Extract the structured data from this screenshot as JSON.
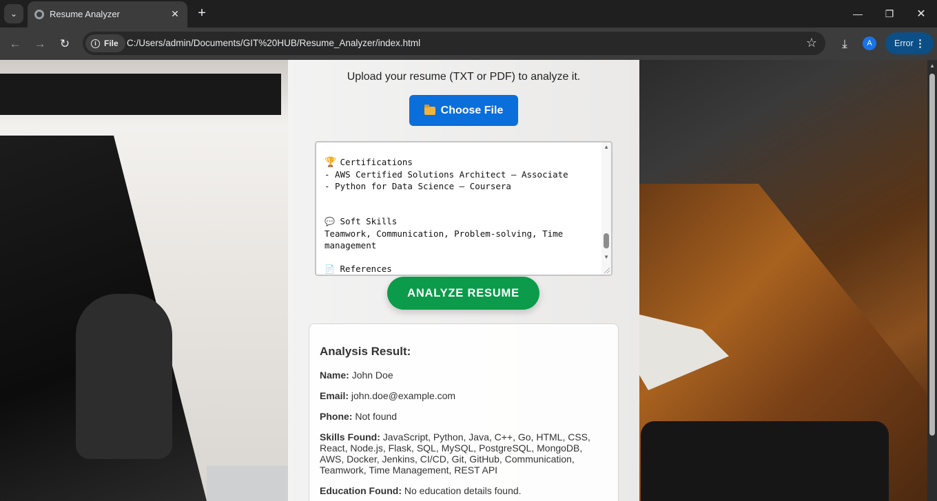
{
  "browser": {
    "tab_title": "Resume Analyzer",
    "chip_label": "File",
    "url": "C:/Users/admin/Documents/GIT%20HUB/Resume_Analyzer/index.html",
    "avatar_letter": "A",
    "error_label": "Error"
  },
  "app": {
    "subtitle": "Upload your resume (TXT or PDF) to analyze it.",
    "choose_file_label": "Choose File",
    "analyze_label": "ANALYZE RESUME",
    "resume_text": {
      "certifications_heading": "Certifications",
      "certification_1": "- AWS Certified Solutions Architect – Associate",
      "certification_2": "- Python for Data Science – Coursera",
      "soft_skills_heading": "Soft Skills",
      "soft_skills_text": "Teamwork, Communication, Problem-solving, Time management",
      "references_heading": "References"
    },
    "result": {
      "heading": "Analysis Result:",
      "rows": [
        {
          "label": "Name:",
          "value": "John Doe"
        },
        {
          "label": "Email:",
          "value": "john.doe@example.com"
        },
        {
          "label": "Phone:",
          "value": "Not found"
        },
        {
          "label": "Skills Found:",
          "value": "JavaScript, Python, Java, C++, Go, HTML, CSS, React, Node.js, Flask, SQL, MySQL, PostgreSQL, MongoDB, AWS, Docker, Jenkins, CI/CD, Git, GitHub, Communication, Teamwork, Time Management, REST API"
        },
        {
          "label": "Education Found:",
          "value": "No education details found."
        }
      ]
    }
  },
  "colors": {
    "choose_button": "#0a6edb",
    "analyze_button": "#0b9b4a",
    "error_pill": "#0b4f86"
  },
  "icons": [
    "tab-search-icon",
    "globe-icon",
    "close-icon",
    "plus-icon",
    "back-icon",
    "forward-icon",
    "reload-icon",
    "info-icon",
    "star-icon",
    "download-icon",
    "kebab-menu-icon",
    "folder-icon",
    "trophy-icon",
    "chat-bubble-icon",
    "document-icon"
  ]
}
